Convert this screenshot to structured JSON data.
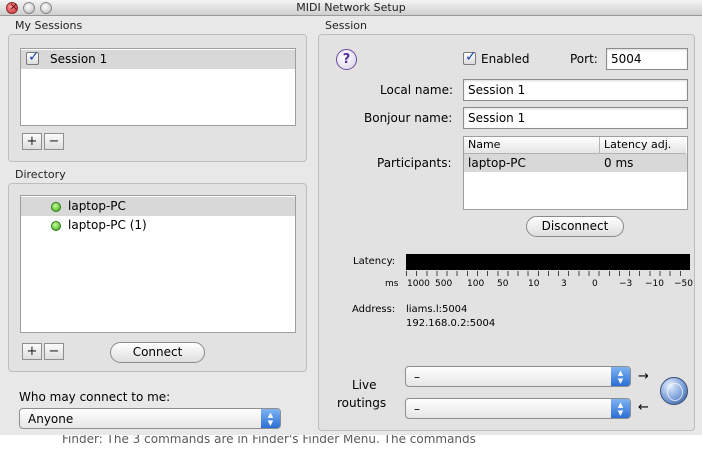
{
  "window": {
    "title": "MIDI Network Setup"
  },
  "my_sessions": {
    "label": "My Sessions",
    "items": [
      {
        "name": "Session 1",
        "checked": true
      }
    ],
    "add_label": "+",
    "remove_label": "−"
  },
  "directory": {
    "label": "Directory",
    "items": [
      {
        "name": "laptop-PC",
        "status": "online"
      },
      {
        "name": "laptop-PC (1)",
        "status": "online"
      }
    ],
    "add_label": "+",
    "remove_label": "−",
    "connect_label": "Connect"
  },
  "who_may_connect": {
    "label": "Who may connect to me:",
    "value": "Anyone"
  },
  "session": {
    "label": "Session",
    "help_label": "?",
    "enabled_label": "Enabled",
    "enabled_checked": true,
    "port_label": "Port:",
    "port_value": "5004",
    "local_name_label": "Local name:",
    "local_name_value": "Session 1",
    "bonjour_name_label": "Bonjour name:",
    "bonjour_name_value": "Session 1",
    "participants_label": "Participants:",
    "participants_columns": [
      "Name",
      "Latency adj."
    ],
    "participants_rows": [
      {
        "name": "laptop-PC",
        "latency": "0 ms"
      }
    ],
    "disconnect_label": "Disconnect",
    "latency_label": "Latency:",
    "latency_scale": [
      "ms",
      "1000",
      "500",
      "100",
      "50",
      "10",
      "3",
      "0",
      "−3",
      "−10",
      "−50"
    ],
    "address_label": "Address:",
    "address_lines": [
      "liams.l:5004",
      "192.168.0.2:5004"
    ],
    "live_routings_label": [
      "Live",
      "routings"
    ],
    "routing_in_value": "–",
    "routing_out_value": "–"
  },
  "background_text": "Finder: The 3 commands are in Finder's Finder Menu. The commands"
}
